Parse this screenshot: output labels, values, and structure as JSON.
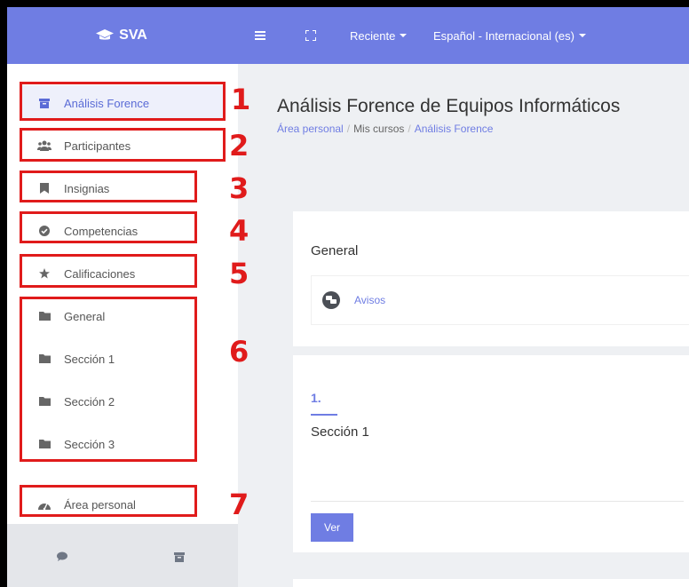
{
  "navbar": {
    "brand": "SVA",
    "recent_label": "Reciente",
    "language_label": "Español - Internacional (es)"
  },
  "sidebar": {
    "items": [
      {
        "label": "Análisis Forence",
        "icon": "archive-icon"
      },
      {
        "label": "Participantes",
        "icon": "users-icon"
      },
      {
        "label": "Insignias",
        "icon": "bookmark-icon"
      },
      {
        "label": "Competencias",
        "icon": "check-circle-icon"
      },
      {
        "label": "Calificaciones",
        "icon": "star-icon"
      },
      {
        "label": "General",
        "icon": "folder-icon"
      },
      {
        "label": "Sección 1",
        "icon": "folder-icon"
      },
      {
        "label": "Sección 2",
        "icon": "folder-icon"
      },
      {
        "label": "Sección 3",
        "icon": "folder-icon"
      },
      {
        "label": "Área personal",
        "icon": "dashboard-icon"
      }
    ]
  },
  "annotations": [
    "1",
    "2",
    "3",
    "4",
    "5",
    "6",
    "7"
  ],
  "main": {
    "title": "Análisis Forence de Equipos Informáticos",
    "breadcrumb": [
      "Área personal",
      "Mis cursos",
      "Análisis Forence"
    ],
    "general": {
      "title": "General",
      "activity": "Avisos"
    },
    "section1": {
      "number": "1.",
      "title": "Sección 1",
      "button": "Ver"
    }
  },
  "colors": {
    "accent": "#6f7de3",
    "annotation": "#e01b1b"
  }
}
